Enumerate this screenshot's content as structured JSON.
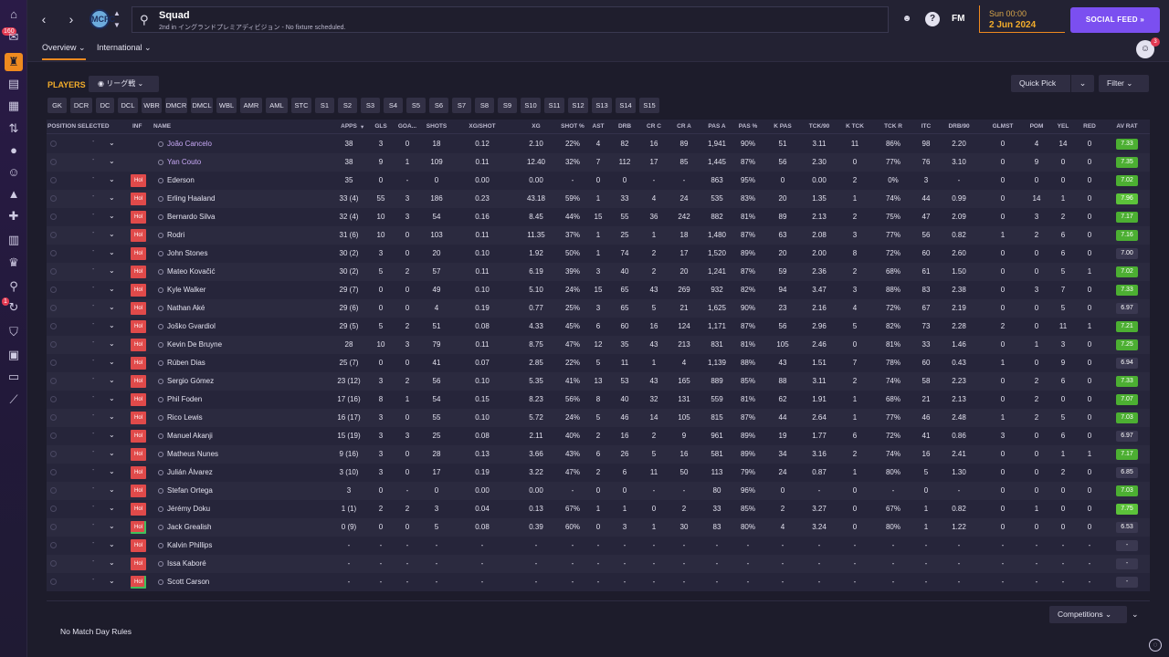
{
  "header": {
    "title": "Squad",
    "subtitle": "2nd in イングランドプレミアディビジョン - No fixture scheduled.",
    "club_crest": "MCFC",
    "fm_label": "FM",
    "time": "Sun 00:00",
    "date": "2 Jun 2024",
    "social_feed": "SOCIAL FEED",
    "social_feed_icon": "»",
    "accent_color": "#ef8a1f",
    "social_color": "#7b4ff0"
  },
  "nav": {
    "inbox_badge": "160",
    "alert_badge": "1"
  },
  "tabs": [
    {
      "label": "Overview ⌄"
    },
    {
      "label": "International ⌄"
    }
  ],
  "user_badge": "3",
  "players_title": "PLAYERS",
  "view_selector": "リーグ戦",
  "quick_pick": "Quick Pick",
  "filter": "Filter",
  "positions": [
    "GK",
    "DCR",
    "DC",
    "DCL",
    "WBR",
    "DMCR",
    "DMCL",
    "WBL",
    "AMR",
    "AML",
    "STC",
    "S1",
    "S2",
    "S3",
    "S4",
    "S5",
    "S6",
    "S7",
    "S8",
    "S9",
    "S10",
    "S11",
    "S12",
    "S13",
    "S14",
    "S15"
  ],
  "columns": [
    "POSITION SELECTED",
    "INF",
    "NAME",
    "APPS",
    "GLS",
    "GOA...",
    "SHOTS",
    "XG/SHOT",
    "XG",
    "SHOT %",
    "AST",
    "DRB",
    "CR C",
    "CR A",
    "PAS A",
    "PAS %",
    "K PAS",
    "TCK/90",
    "K TCK",
    "TCK R",
    "ITC",
    "DRB/90",
    "GLMST",
    "POM",
    "YEL",
    "RED",
    "AV RAT"
  ],
  "players": [
    {
      "name": "João Cancelo",
      "purple": true,
      "inf": "",
      "apps": "38",
      "gls": "3",
      "goa": "0",
      "shots": "18",
      "xgshot": "0.12",
      "xg": "2.10",
      "shotpct": "22%",
      "ast": "4",
      "drb": "82",
      "crc": "16",
      "cra": "89",
      "pasa": "1,941",
      "paspct": "90%",
      "kpas": "51",
      "tck90": "3.11",
      "ktck": "11",
      "tckr": "86%",
      "itc": "98",
      "drb90": "2.20",
      "glmst": "0",
      "pom": "4",
      "yel": "14",
      "red": "0",
      "avrat": "7.33",
      "ratcolor": "#4caf32"
    },
    {
      "name": "Yan Couto",
      "purple": true,
      "inf": "",
      "apps": "38",
      "gls": "9",
      "goa": "1",
      "shots": "109",
      "xgshot": "0.11",
      "xg": "12.40",
      "shotpct": "32%",
      "ast": "7",
      "drb": "112",
      "crc": "17",
      "cra": "85",
      "pasa": "1,445",
      "paspct": "87%",
      "kpas": "56",
      "tck90": "2.30",
      "ktck": "0",
      "tckr": "77%",
      "itc": "76",
      "drb90": "3.10",
      "glmst": "0",
      "pom": "9",
      "yel": "0",
      "red": "0",
      "avrat": "7.35",
      "ratcolor": "#4caf32"
    },
    {
      "name": "Ederson",
      "purple": false,
      "inf": "Hol",
      "apps": "35",
      "gls": "0",
      "goa": "-",
      "shots": "0",
      "xgshot": "0.00",
      "xg": "0.00",
      "shotpct": "-",
      "ast": "0",
      "drb": "0",
      "crc": "-",
      "cra": "-",
      "pasa": "863",
      "paspct": "95%",
      "kpas": "0",
      "tck90": "0.00",
      "ktck": "2",
      "tckr": "0%",
      "itc": "3",
      "drb90": "-",
      "glmst": "0",
      "pom": "0",
      "yel": "0",
      "red": "0",
      "avrat": "7.02",
      "ratcolor": "#4caf32"
    },
    {
      "name": "Erling Haaland",
      "purple": false,
      "inf": "Hol",
      "apps": "33 (4)",
      "gls": "55",
      "goa": "3",
      "shots": "186",
      "xgshot": "0.23",
      "xg": "43.18",
      "shotpct": "59%",
      "ast": "1",
      "drb": "33",
      "crc": "4",
      "cra": "24",
      "pasa": "535",
      "paspct": "83%",
      "kpas": "20",
      "tck90": "1.35",
      "ktck": "1",
      "tckr": "74%",
      "itc": "44",
      "drb90": "0.99",
      "glmst": "0",
      "pom": "14",
      "yel": "1",
      "red": "0",
      "avrat": "7.96",
      "ratcolor": "#5cc23a"
    },
    {
      "name": "Bernardo Silva",
      "purple": false,
      "inf": "Hol",
      "apps": "32 (4)",
      "gls": "10",
      "goa": "3",
      "shots": "54",
      "xgshot": "0.16",
      "xg": "8.45",
      "shotpct": "44%",
      "ast": "15",
      "drb": "55",
      "crc": "36",
      "cra": "242",
      "pasa": "882",
      "paspct": "81%",
      "kpas": "89",
      "tck90": "2.13",
      "ktck": "2",
      "tckr": "75%",
      "itc": "47",
      "drb90": "2.09",
      "glmst": "0",
      "pom": "3",
      "yel": "2",
      "red": "0",
      "avrat": "7.17",
      "ratcolor": "#4caf32"
    },
    {
      "name": "Rodri",
      "purple": false,
      "inf": "Hol",
      "apps": "31 (6)",
      "gls": "10",
      "goa": "0",
      "shots": "103",
      "xgshot": "0.11",
      "xg": "11.35",
      "shotpct": "37%",
      "ast": "1",
      "drb": "25",
      "crc": "1",
      "cra": "18",
      "pasa": "1,480",
      "paspct": "87%",
      "kpas": "63",
      "tck90": "2.08",
      "ktck": "3",
      "tckr": "77%",
      "itc": "56",
      "drb90": "0.82",
      "glmst": "1",
      "pom": "2",
      "yel": "6",
      "red": "0",
      "avrat": "7.16",
      "ratcolor": "#4caf32"
    },
    {
      "name": "John Stones",
      "purple": false,
      "inf": "Hol",
      "apps": "30 (2)",
      "gls": "3",
      "goa": "0",
      "shots": "20",
      "xgshot": "0.10",
      "xg": "1.92",
      "shotpct": "50%",
      "ast": "1",
      "drb": "74",
      "crc": "2",
      "cra": "17",
      "pasa": "1,520",
      "paspct": "89%",
      "kpas": "20",
      "tck90": "2.00",
      "ktck": "8",
      "tckr": "72%",
      "itc": "60",
      "drb90": "2.60",
      "glmst": "0",
      "pom": "0",
      "yel": "6",
      "red": "0",
      "avrat": "7.00",
      "ratcolor": "#3a3850"
    },
    {
      "name": "Mateo Kovačić",
      "purple": false,
      "inf": "Hol",
      "apps": "30 (2)",
      "gls": "5",
      "goa": "2",
      "shots": "57",
      "xgshot": "0.11",
      "xg": "6.19",
      "shotpct": "39%",
      "ast": "3",
      "drb": "40",
      "crc": "2",
      "cra": "20",
      "pasa": "1,241",
      "paspct": "87%",
      "kpas": "59",
      "tck90": "2.36",
      "ktck": "2",
      "tckr": "68%",
      "itc": "61",
      "drb90": "1.50",
      "glmst": "0",
      "pom": "0",
      "yel": "5",
      "red": "1",
      "avrat": "7.02",
      "ratcolor": "#4caf32"
    },
    {
      "name": "Kyle Walker",
      "purple": false,
      "inf": "Hol",
      "apps": "29 (7)",
      "gls": "0",
      "goa": "0",
      "shots": "49",
      "xgshot": "0.10",
      "xg": "5.10",
      "shotpct": "24%",
      "ast": "15",
      "drb": "65",
      "crc": "43",
      "cra": "269",
      "pasa": "932",
      "paspct": "82%",
      "kpas": "94",
      "tck90": "3.47",
      "ktck": "3",
      "tckr": "88%",
      "itc": "83",
      "drb90": "2.38",
      "glmst": "0",
      "pom": "3",
      "yel": "7",
      "red": "0",
      "avrat": "7.33",
      "ratcolor": "#4caf32"
    },
    {
      "name": "Nathan Aké",
      "purple": false,
      "inf": "Hol",
      "apps": "29 (6)",
      "gls": "0",
      "goa": "0",
      "shots": "4",
      "xgshot": "0.19",
      "xg": "0.77",
      "shotpct": "25%",
      "ast": "3",
      "drb": "65",
      "crc": "5",
      "cra": "21",
      "pasa": "1,625",
      "paspct": "90%",
      "kpas": "23",
      "tck90": "2.16",
      "ktck": "4",
      "tckr": "72%",
      "itc": "67",
      "drb90": "2.19",
      "glmst": "0",
      "pom": "0",
      "yel": "5",
      "red": "0",
      "avrat": "6.97",
      "ratcolor": "#3a3850"
    },
    {
      "name": "Joško Gvardiol",
      "purple": false,
      "inf": "Hol",
      "apps": "29 (5)",
      "gls": "5",
      "goa": "2",
      "shots": "51",
      "xgshot": "0.08",
      "xg": "4.33",
      "shotpct": "45%",
      "ast": "6",
      "drb": "60",
      "crc": "16",
      "cra": "124",
      "pasa": "1,171",
      "paspct": "87%",
      "kpas": "56",
      "tck90": "2.96",
      "ktck": "5",
      "tckr": "82%",
      "itc": "73",
      "drb90": "2.28",
      "glmst": "2",
      "pom": "0",
      "yel": "11",
      "red": "1",
      "avrat": "7.21",
      "ratcolor": "#4caf32"
    },
    {
      "name": "Kevin De Bruyne",
      "purple": false,
      "inf": "Hol",
      "apps": "28",
      "gls": "10",
      "goa": "3",
      "shots": "79",
      "xgshot": "0.11",
      "xg": "8.75",
      "shotpct": "47%",
      "ast": "12",
      "drb": "35",
      "crc": "43",
      "cra": "213",
      "pasa": "831",
      "paspct": "81%",
      "kpas": "105",
      "tck90": "2.46",
      "ktck": "0",
      "tckr": "81%",
      "itc": "33",
      "drb90": "1.46",
      "glmst": "0",
      "pom": "1",
      "yel": "3",
      "red": "0",
      "avrat": "7.25",
      "ratcolor": "#4caf32"
    },
    {
      "name": "Rúben Dias",
      "purple": false,
      "inf": "Hol",
      "apps": "25 (7)",
      "gls": "0",
      "goa": "0",
      "shots": "41",
      "xgshot": "0.07",
      "xg": "2.85",
      "shotpct": "22%",
      "ast": "5",
      "drb": "11",
      "crc": "1",
      "cra": "4",
      "pasa": "1,139",
      "paspct": "88%",
      "kpas": "43",
      "tck90": "1.51",
      "ktck": "7",
      "tckr": "78%",
      "itc": "60",
      "drb90": "0.43",
      "glmst": "1",
      "pom": "0",
      "yel": "9",
      "red": "0",
      "avrat": "6.94",
      "ratcolor": "#3a3850"
    },
    {
      "name": "Sergio Gómez",
      "purple": false,
      "inf": "Hol",
      "apps": "23 (12)",
      "gls": "3",
      "goa": "2",
      "shots": "56",
      "xgshot": "0.10",
      "xg": "5.35",
      "shotpct": "41%",
      "ast": "13",
      "drb": "53",
      "crc": "43",
      "cra": "165",
      "pasa": "889",
      "paspct": "85%",
      "kpas": "88",
      "tck90": "3.11",
      "ktck": "2",
      "tckr": "74%",
      "itc": "58",
      "drb90": "2.23",
      "glmst": "0",
      "pom": "2",
      "yel": "6",
      "red": "0",
      "avrat": "7.33",
      "ratcolor": "#4caf32"
    },
    {
      "name": "Phil Foden",
      "purple": false,
      "inf": "Hol",
      "apps": "17 (16)",
      "gls": "8",
      "goa": "1",
      "shots": "54",
      "xgshot": "0.15",
      "xg": "8.23",
      "shotpct": "56%",
      "ast": "8",
      "drb": "40",
      "crc": "32",
      "cra": "131",
      "pasa": "559",
      "paspct": "81%",
      "kpas": "62",
      "tck90": "1.91",
      "ktck": "1",
      "tckr": "68%",
      "itc": "21",
      "drb90": "2.13",
      "glmst": "0",
      "pom": "2",
      "yel": "0",
      "red": "0",
      "avrat": "7.07",
      "ratcolor": "#4caf32"
    },
    {
      "name": "Rico Lewis",
      "purple": false,
      "inf": "Hol",
      "apps": "16 (17)",
      "gls": "3",
      "goa": "0",
      "shots": "55",
      "xgshot": "0.10",
      "xg": "5.72",
      "shotpct": "24%",
      "ast": "5",
      "drb": "46",
      "crc": "14",
      "cra": "105",
      "pasa": "815",
      "paspct": "87%",
      "kpas": "44",
      "tck90": "2.64",
      "ktck": "1",
      "tckr": "77%",
      "itc": "46",
      "drb90": "2.48",
      "glmst": "1",
      "pom": "2",
      "yel": "5",
      "red": "0",
      "avrat": "7.03",
      "ratcolor": "#4caf32"
    },
    {
      "name": "Manuel Akanji",
      "purple": false,
      "inf": "Hol",
      "apps": "15 (19)",
      "gls": "3",
      "goa": "3",
      "shots": "25",
      "xgshot": "0.08",
      "xg": "2.11",
      "shotpct": "40%",
      "ast": "2",
      "drb": "16",
      "crc": "2",
      "cra": "9",
      "pasa": "961",
      "paspct": "89%",
      "kpas": "19",
      "tck90": "1.77",
      "ktck": "6",
      "tckr": "72%",
      "itc": "41",
      "drb90": "0.86",
      "glmst": "3",
      "pom": "0",
      "yel": "6",
      "red": "0",
      "avrat": "6.97",
      "ratcolor": "#3a3850"
    },
    {
      "name": "Matheus Nunes",
      "purple": false,
      "inf": "Hol",
      "apps": "9 (16)",
      "gls": "3",
      "goa": "0",
      "shots": "28",
      "xgshot": "0.13",
      "xg": "3.66",
      "shotpct": "43%",
      "ast": "6",
      "drb": "26",
      "crc": "5",
      "cra": "16",
      "pasa": "581",
      "paspct": "89%",
      "kpas": "34",
      "tck90": "3.16",
      "ktck": "2",
      "tckr": "74%",
      "itc": "16",
      "drb90": "2.41",
      "glmst": "0",
      "pom": "0",
      "yel": "1",
      "red": "1",
      "avrat": "7.17",
      "ratcolor": "#4caf32"
    },
    {
      "name": "Julián Álvarez",
      "purple": false,
      "inf": "Hol",
      "apps": "3 (10)",
      "gls": "3",
      "goa": "0",
      "shots": "17",
      "xgshot": "0.19",
      "xg": "3.22",
      "shotpct": "47%",
      "ast": "2",
      "drb": "6",
      "crc": "11",
      "cra": "50",
      "pasa": "113",
      "paspct": "79%",
      "kpas": "24",
      "tck90": "0.87",
      "ktck": "1",
      "tckr": "80%",
      "itc": "5",
      "drb90": "1.30",
      "glmst": "0",
      "pom": "0",
      "yel": "2",
      "red": "0",
      "avrat": "6.85",
      "ratcolor": "#3a3850"
    },
    {
      "name": "Stefan Ortega",
      "purple": false,
      "inf": "Hol",
      "apps": "3",
      "gls": "0",
      "goa": "-",
      "shots": "0",
      "xgshot": "0.00",
      "xg": "0.00",
      "shotpct": "-",
      "ast": "0",
      "drb": "0",
      "crc": "-",
      "cra": "-",
      "pasa": "80",
      "paspct": "96%",
      "kpas": "0",
      "tck90": "-",
      "ktck": "0",
      "tckr": "-",
      "itc": "0",
      "drb90": "-",
      "glmst": "0",
      "pom": "0",
      "yel": "0",
      "red": "0",
      "avrat": "7.03",
      "ratcolor": "#4caf32"
    },
    {
      "name": "Jérémy Doku",
      "purple": false,
      "inf": "Hol",
      "apps": "1 (1)",
      "gls": "2",
      "goa": "2",
      "shots": "3",
      "xgshot": "0.04",
      "xg": "0.13",
      "shotpct": "67%",
      "ast": "1",
      "drb": "1",
      "crc": "0",
      "cra": "2",
      "pasa": "33",
      "paspct": "85%",
      "kpas": "2",
      "tck90": "3.27",
      "ktck": "0",
      "tckr": "67%",
      "itc": "1",
      "drb90": "0.82",
      "glmst": "0",
      "pom": "1",
      "yel": "0",
      "red": "0",
      "avrat": "7.75",
      "ratcolor": "#5cc23a"
    },
    {
      "name": "Jack Grealish",
      "purple": false,
      "inf": "Hol",
      "green": true,
      "apps": "0 (9)",
      "gls": "0",
      "goa": "0",
      "shots": "5",
      "xgshot": "0.08",
      "xg": "0.39",
      "shotpct": "60%",
      "ast": "0",
      "drb": "3",
      "crc": "1",
      "cra": "30",
      "pasa": "83",
      "paspct": "80%",
      "kpas": "4",
      "tck90": "3.24",
      "ktck": "0",
      "tckr": "80%",
      "itc": "1",
      "drb90": "1.22",
      "glmst": "0",
      "pom": "0",
      "yel": "0",
      "red": "0",
      "avrat": "6.53",
      "ratcolor": "#3a3850"
    },
    {
      "name": "Kalvin Phillips",
      "purple": false,
      "inf": "Hol",
      "apps": "-",
      "gls": "-",
      "goa": "-",
      "shots": "-",
      "xgshot": "-",
      "xg": "-",
      "shotpct": "-",
      "ast": "-",
      "drb": "-",
      "crc": "-",
      "cra": "-",
      "pasa": "-",
      "paspct": "-",
      "kpas": "-",
      "tck90": "-",
      "ktck": "-",
      "tckr": "-",
      "itc": "-",
      "drb90": "-",
      "glmst": "-",
      "pom": "-",
      "yel": "-",
      "red": "-",
      "avrat": "-",
      "ratcolor": "#3a3850"
    },
    {
      "name": "Issa Kaboré",
      "purple": false,
      "inf": "Hol",
      "apps": "-",
      "gls": "-",
      "goa": "-",
      "shots": "-",
      "xgshot": "-",
      "xg": "-",
      "shotpct": "-",
      "ast": "-",
      "drb": "-",
      "crc": "-",
      "cra": "-",
      "pasa": "-",
      "paspct": "-",
      "kpas": "-",
      "tck90": "-",
      "ktck": "-",
      "tckr": "-",
      "itc": "-",
      "drb90": "-",
      "glmst": "-",
      "pom": "-",
      "yel": "-",
      "red": "-",
      "avrat": "-",
      "ratcolor": "#3a3850"
    },
    {
      "name": "Scott Carson",
      "purple": false,
      "inf": "Hol",
      "green": true,
      "apps": "-",
      "gls": "-",
      "goa": "-",
      "shots": "-",
      "xgshot": "-",
      "xg": "-",
      "shotpct": "-",
      "ast": "-",
      "drb": "-",
      "crc": "-",
      "cra": "-",
      "pasa": "-",
      "paspct": "-",
      "kpas": "-",
      "tck90": "-",
      "ktck": "-",
      "tckr": "-",
      "itc": "-",
      "drb90": "-",
      "glmst": "-",
      "pom": "-",
      "yel": "-",
      "red": "-",
      "avrat": "-",
      "ratcolor": "#3a3850"
    }
  ],
  "competitions": "Competitions",
  "no_match_day_rules": "No Match Day Rules"
}
